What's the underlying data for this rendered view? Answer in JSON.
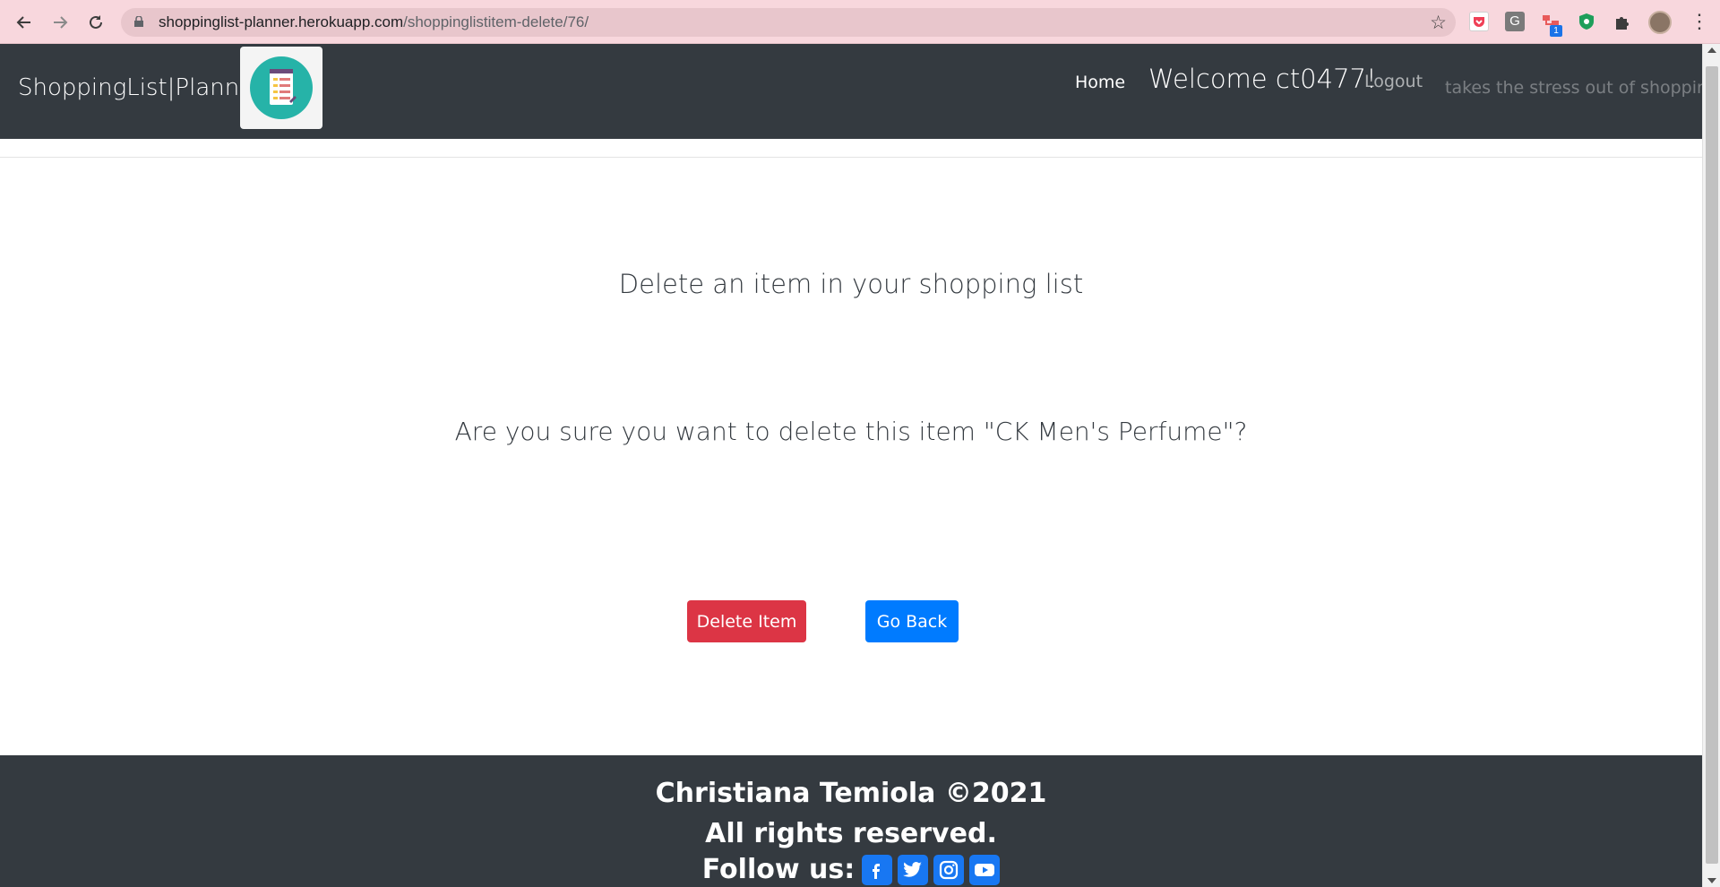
{
  "browser": {
    "url_host": "shoppinglist-planner.herokuapp.com",
    "url_path": "/shoppinglistitem-delete/76/",
    "extension_badge": "1"
  },
  "navbar": {
    "brand": "ShoppingList|Planner",
    "home": "Home",
    "welcome": "Welcome ct0477!",
    "logout": "Logout",
    "tagline": "takes the stress out of shopping"
  },
  "main": {
    "title": "Delete an item in your shopping list",
    "confirm": "Are you sure you want to delete this item \"CK Men's Perfume\"?",
    "delete_label": "Delete Item",
    "back_label": "Go Back"
  },
  "footer": {
    "copyright": "Christiana Temiola ©2021",
    "rights": "All rights reserved.",
    "follow": "Follow us:",
    "social": [
      "facebook-icon",
      "twitter-icon",
      "instagram-icon",
      "youtube-icon"
    ]
  },
  "colors": {
    "navbar_bg": "#343a40",
    "danger": "#dc3545",
    "primary": "#007bff",
    "social": "#1877f2"
  }
}
